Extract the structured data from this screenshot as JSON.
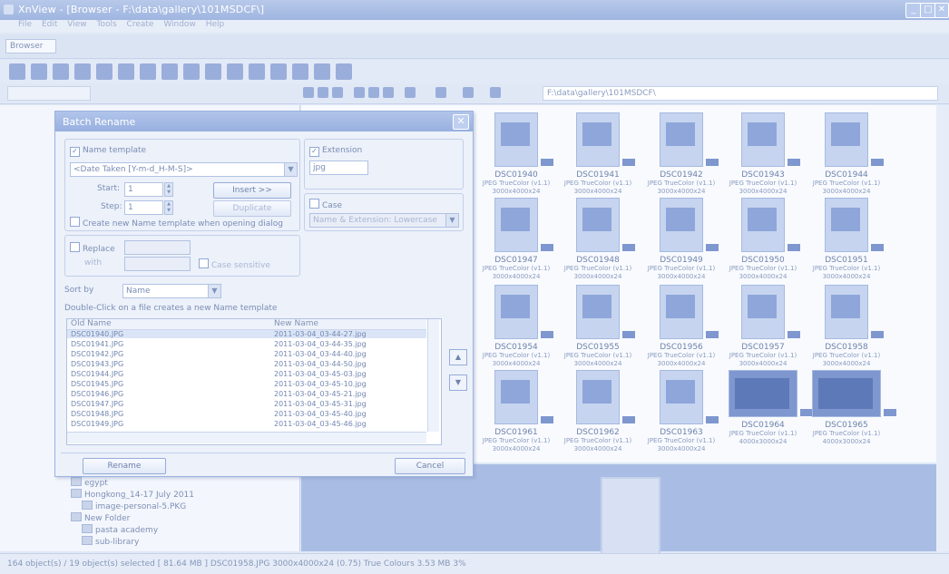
{
  "window": {
    "title": "XnView - [Browser - F:\\data\\gallery\\101MSDCF\\]"
  },
  "menu": [
    "File",
    "Edit",
    "View",
    "Tools",
    "Create",
    "Window",
    "Help"
  ],
  "tab": {
    "label": "Browser"
  },
  "address": {
    "path": "F:\\data\\gallery\\101MSDCF\\"
  },
  "thumbnails": [
    {
      "name": "DSC01940",
      "type": "JPEG TrueColor (v1.1)",
      "dims": "3000x4000x24"
    },
    {
      "name": "DSC01941",
      "type": "JPEG TrueColor (v1.1)",
      "dims": "3000x4000x24"
    },
    {
      "name": "DSC01942",
      "type": "JPEG TrueColor (v1.1)",
      "dims": "3000x4000x24"
    },
    {
      "name": "DSC01943",
      "type": "JPEG TrueColor (v1.1)",
      "dims": "3000x4000x24"
    },
    {
      "name": "DSC01944",
      "type": "JPEG TrueColor (v1.1)",
      "dims": "3000x4000x24"
    },
    {
      "name": "DSC01947",
      "type": "JPEG TrueColor (v1.1)",
      "dims": "3000x4000x24"
    },
    {
      "name": "DSC01948",
      "type": "JPEG TrueColor (v1.1)",
      "dims": "3000x4000x24"
    },
    {
      "name": "DSC01949",
      "type": "JPEG TrueColor (v1.1)",
      "dims": "3000x4000x24"
    },
    {
      "name": "DSC01950",
      "type": "JPEG TrueColor (v1.1)",
      "dims": "3000x4000x24"
    },
    {
      "name": "DSC01951",
      "type": "JPEG TrueColor (v1.1)",
      "dims": "3000x4000x24"
    },
    {
      "name": "DSC01954",
      "type": "JPEG TrueColor (v1.1)",
      "dims": "3000x4000x24"
    },
    {
      "name": "DSC01955",
      "type": "JPEG TrueColor (v1.1)",
      "dims": "3000x4000x24"
    },
    {
      "name": "DSC01956",
      "type": "JPEG TrueColor (v1.1)",
      "dims": "3000x4000x24"
    },
    {
      "name": "DSC01957",
      "type": "JPEG TrueColor (v1.1)",
      "dims": "3000x4000x24"
    },
    {
      "name": "DSC01958",
      "type": "JPEG TrueColor (v1.1)",
      "dims": "3000x4000x24"
    },
    {
      "name": "DSC01961",
      "type": "JPEG TrueColor (v1.1)",
      "dims": "3000x4000x24"
    },
    {
      "name": "DSC01962",
      "type": "JPEG TrueColor (v1.1)",
      "dims": "3000x4000x24"
    },
    {
      "name": "DSC01963",
      "type": "JPEG TrueColor (v1.1)",
      "dims": "3000x4000x24"
    },
    {
      "name": "DSC01964",
      "type": "JPEG TrueColor (v1.1)",
      "dims": "4000x3000x24"
    },
    {
      "name": "DSC01965",
      "type": "JPEG TrueColor (v1.1)",
      "dims": "4000x3000x24"
    }
  ],
  "tree": [
    "egypt",
    "Hongkong_14-17 July 2011",
    "image-personal-5.PKG",
    "New Folder",
    "pasta academy",
    "sub-library"
  ],
  "dialog": {
    "title": "Batch Rename",
    "name_template_label": "Name template",
    "name_template_value": "<Date Taken [Y-m-d_H-M-S]>",
    "start_label": "Start:",
    "start_value": "1",
    "step_label": "Step:",
    "step_value": "1",
    "insert_btn": "Insert >>",
    "duplicate_btn": "Duplicate",
    "create_new_label": "Create new Name template when opening dialog",
    "extension_label": "Extension",
    "extension_value": "jpg",
    "case_label": "Case",
    "case_value": "Name & Extension: Lowercase",
    "replace_label": "Replace",
    "with_label": "with",
    "case_sensitive_label": "Case sensitive",
    "sort_label": "Sort by",
    "sort_value": "Name",
    "hint": "Double-Click on a file creates a new Name template",
    "col_old": "Old Name",
    "col_new": "New Name",
    "rows": [
      {
        "old": "DSC01940.JPG",
        "new": "2011-03-04_03-44-27.jpg"
      },
      {
        "old": "DSC01941.JPG",
        "new": "2011-03-04_03-44-35.jpg"
      },
      {
        "old": "DSC01942.JPG",
        "new": "2011-03-04_03-44-40.jpg"
      },
      {
        "old": "DSC01943.JPG",
        "new": "2011-03-04_03-44-50.jpg"
      },
      {
        "old": "DSC01944.JPG",
        "new": "2011-03-04_03-45-03.jpg"
      },
      {
        "old": "DSC01945.JPG",
        "new": "2011-03-04_03-45-10.jpg"
      },
      {
        "old": "DSC01946.JPG",
        "new": "2011-03-04_03-45-21.jpg"
      },
      {
        "old": "DSC01947.JPG",
        "new": "2011-03-04_03-45-31.jpg"
      },
      {
        "old": "DSC01948.JPG",
        "new": "2011-03-04_03-45-40.jpg"
      },
      {
        "old": "DSC01949.JPG",
        "new": "2011-03-04_03-45-46.jpg"
      }
    ],
    "rename_btn": "Rename",
    "cancel_btn": "Cancel"
  },
  "status": {
    "text": "164 object(s) / 19 object(s) selected   [ 81.64 MB ]   DSC01958.JPG   3000x4000x24 (0.75)   True Colours   3.53 MB   3%"
  }
}
